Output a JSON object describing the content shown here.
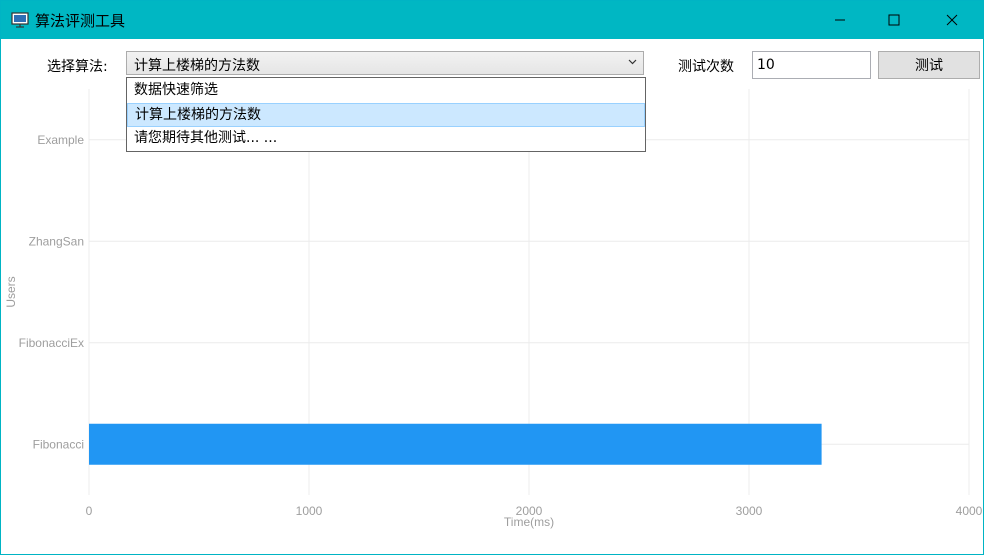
{
  "window": {
    "title": "算法评测工具",
    "icon": "monitor-app-icon",
    "controls": [
      "minimize-icon",
      "maximize-icon",
      "close-icon"
    ]
  },
  "toolbar": {
    "algorithm_label": "选择算法:",
    "algorithm_selected": "计算上楼梯的方法数",
    "count_label": "测试次数",
    "count_value": "10",
    "test_button": "测试"
  },
  "dropdown": {
    "options": [
      "数据快速筛选",
      "计算上楼梯的方法数",
      "请您期待其他测试... ..."
    ],
    "selected_index": 1
  },
  "colors": {
    "titlebar": "#00b7c3",
    "bar": "#2196f3",
    "selection": "#cce8ff"
  },
  "chart_data": {
    "type": "bar",
    "orientation": "horizontal",
    "categories": [
      "Example",
      "ZhangSan",
      "FibonacciEx",
      "Fibonacci"
    ],
    "values": [
      0,
      0,
      0,
      3330
    ],
    "xlabel": "Time(ms)",
    "ylabel": "Users",
    "xlim": [
      0,
      4000
    ],
    "xticks": [
      0,
      1000,
      2000,
      3000,
      4000
    ],
    "grid": true
  }
}
